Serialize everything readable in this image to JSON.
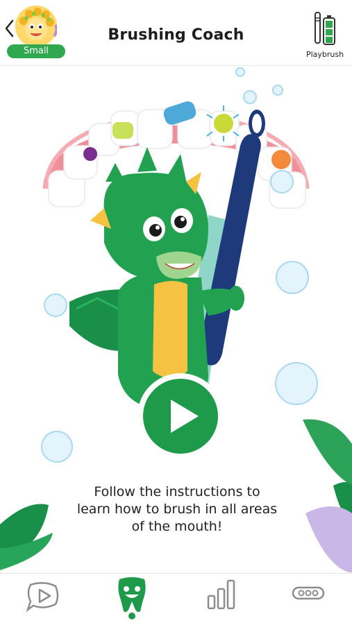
{
  "header": {
    "title": "Brushing Coach",
    "profile_size": "Small",
    "brush_label": "Playbrush"
  },
  "main": {
    "instruction": "Follow the instructions to learn how to brush in all areas of the mouth!"
  },
  "tabs": [
    {
      "name": "play-icon",
      "active": false
    },
    {
      "name": "tooth-icon",
      "active": true
    },
    {
      "name": "stats-icon",
      "active": false
    },
    {
      "name": "more-icon",
      "active": false
    }
  ],
  "colors": {
    "accent_green": "#1f9a4b",
    "badge_green": "#2fa84f",
    "gum_pink": "#ee8f9a",
    "brush_navy": "#1e3a7b"
  }
}
